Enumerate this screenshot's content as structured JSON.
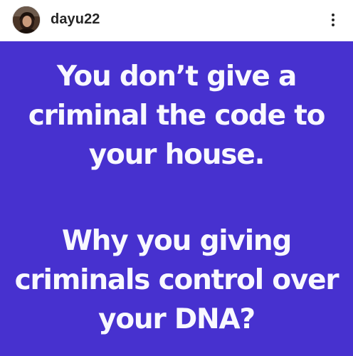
{
  "post": {
    "username": "dayu22",
    "avatar_icon": "profile-photo-avatar",
    "more_icon": "vertical-ellipsis-icon"
  },
  "image": {
    "background_color": "#4731cf",
    "text_color": "#ffffff",
    "paragraph_1": {
      "lines": [
        "You don’t give a",
        "criminal the code to",
        "your house."
      ]
    },
    "paragraph_2": {
      "lines": [
        "Why you giving",
        "criminals control over",
        "your DNA?"
      ]
    }
  }
}
